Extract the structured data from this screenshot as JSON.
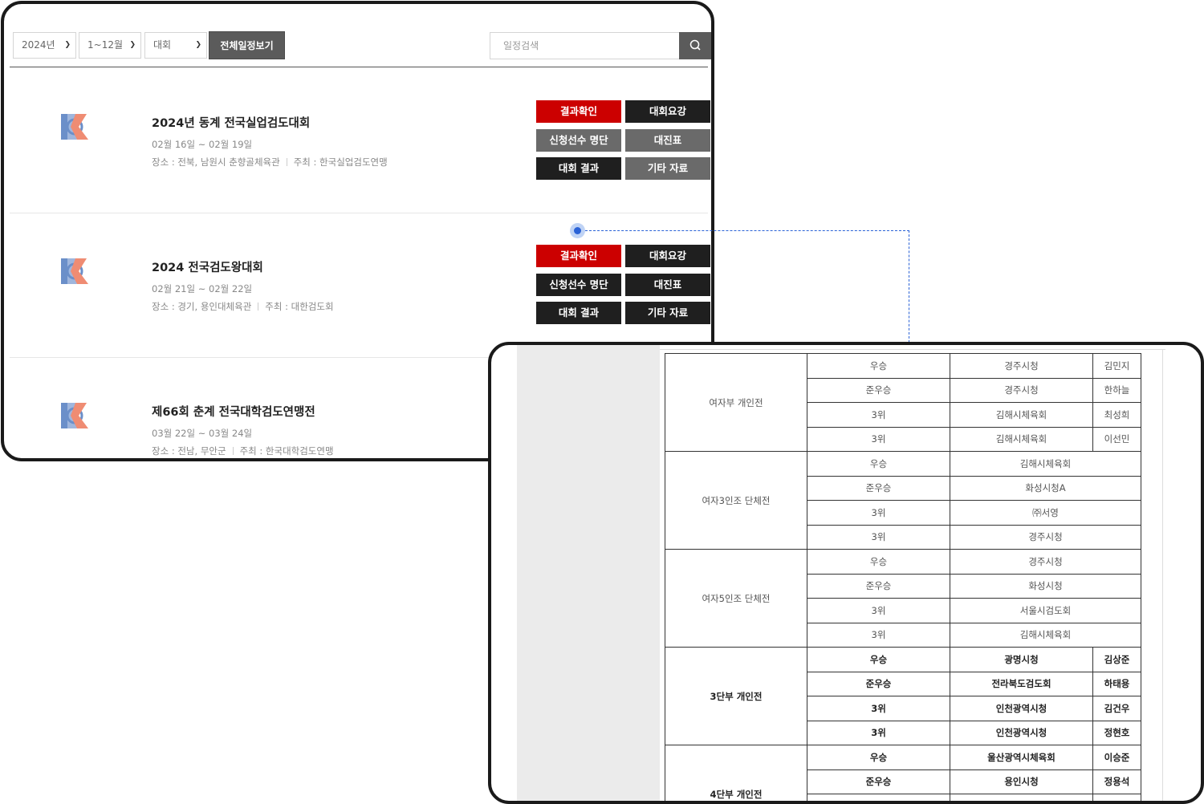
{
  "toolbar": {
    "year": "2024년",
    "month": "1~12월",
    "kind": "대회",
    "all_schedule": "전체일정보기",
    "search_placeholder": "일정검색"
  },
  "events": [
    {
      "title": "2024년 동계 전국실업검도대회",
      "date": "02월 16일 ~ 02월 19일",
      "venue": "장소 : 전북, 남원시 춘향골체육관",
      "host": "주최 : 한국실업검도연맹",
      "buttons": [
        "결과확인",
        "대회요강",
        "신청선수 명단",
        "대진표",
        "대회 결과",
        "기타 자료"
      ]
    },
    {
      "title": "2024 전국검도왕대회",
      "date": "02월 21일 ~ 02월 22일",
      "venue": "장소 : 경기, 용인대체육관",
      "host": "주최 : 대한검도회",
      "buttons": [
        "결과확인",
        "대회요강",
        "신청선수 명단",
        "대진표",
        "대회 결과",
        "기타 자료"
      ]
    },
    {
      "title": "제66회 춘계 전국대학검도연맹전",
      "date": "03월 22일 ~ 03월 24일",
      "venue": "장소 : 전남, 무안군",
      "host": "주최 : 한국대학검도연맹"
    }
  ],
  "results": [
    {
      "category": "여자부 개인전",
      "bold": false,
      "rows": [
        {
          "rank": "우승",
          "team": "경주시청",
          "name": "김민지"
        },
        {
          "rank": "준우승",
          "team": "경주시청",
          "name": "한하늘"
        },
        {
          "rank": "3위",
          "team": "김해시체육회",
          "name": "최성희"
        },
        {
          "rank": "3위",
          "team": "김해시체육회",
          "name": "이선민"
        }
      ]
    },
    {
      "category": "여자3인조 단체전",
      "bold": false,
      "rows": [
        {
          "rank": "우승",
          "team": "김해시체육회"
        },
        {
          "rank": "준우승",
          "team": "화성시청A"
        },
        {
          "rank": "3위",
          "team": "㈜서영"
        },
        {
          "rank": "3위",
          "team": "경주시청"
        }
      ]
    },
    {
      "category": "여자5인조 단체전",
      "bold": false,
      "rows": [
        {
          "rank": "우승",
          "team": "경주시청"
        },
        {
          "rank": "준우승",
          "team": "화성시청"
        },
        {
          "rank": "3위",
          "team": "서울시검도회"
        },
        {
          "rank": "3위",
          "team": "김해시체육회"
        }
      ]
    },
    {
      "category": "3단부 개인전",
      "bold": true,
      "rows": [
        {
          "rank": "우승",
          "team": "광명시청",
          "name": "김상준"
        },
        {
          "rank": "준우승",
          "team": "전라북도검도회",
          "name": "하태용"
        },
        {
          "rank": "3위",
          "team": "인천광역시청",
          "name": "김건우"
        },
        {
          "rank": "3위",
          "team": "인천광역시청",
          "name": "정현호"
        }
      ]
    },
    {
      "category": "4단부 개인전",
      "bold": true,
      "rows": [
        {
          "rank": "우승",
          "team": "울산광역시체육회",
          "name": "이승준"
        },
        {
          "rank": "준우승",
          "team": "용인시청",
          "name": "정용석"
        },
        {
          "rank": "",
          "team": "",
          "name": ""
        },
        {
          "rank": "",
          "team": "",
          "name": ""
        }
      ]
    }
  ],
  "colors": {
    "red_button": "#cc0000",
    "black_button": "#1f1f1f",
    "gray_button": "#6a6a6a",
    "connector": "#2a62d6"
  },
  "icons": {
    "search": "search-icon",
    "chevron": "chevron-down-icon",
    "logo": "kendo-logo-icon"
  }
}
